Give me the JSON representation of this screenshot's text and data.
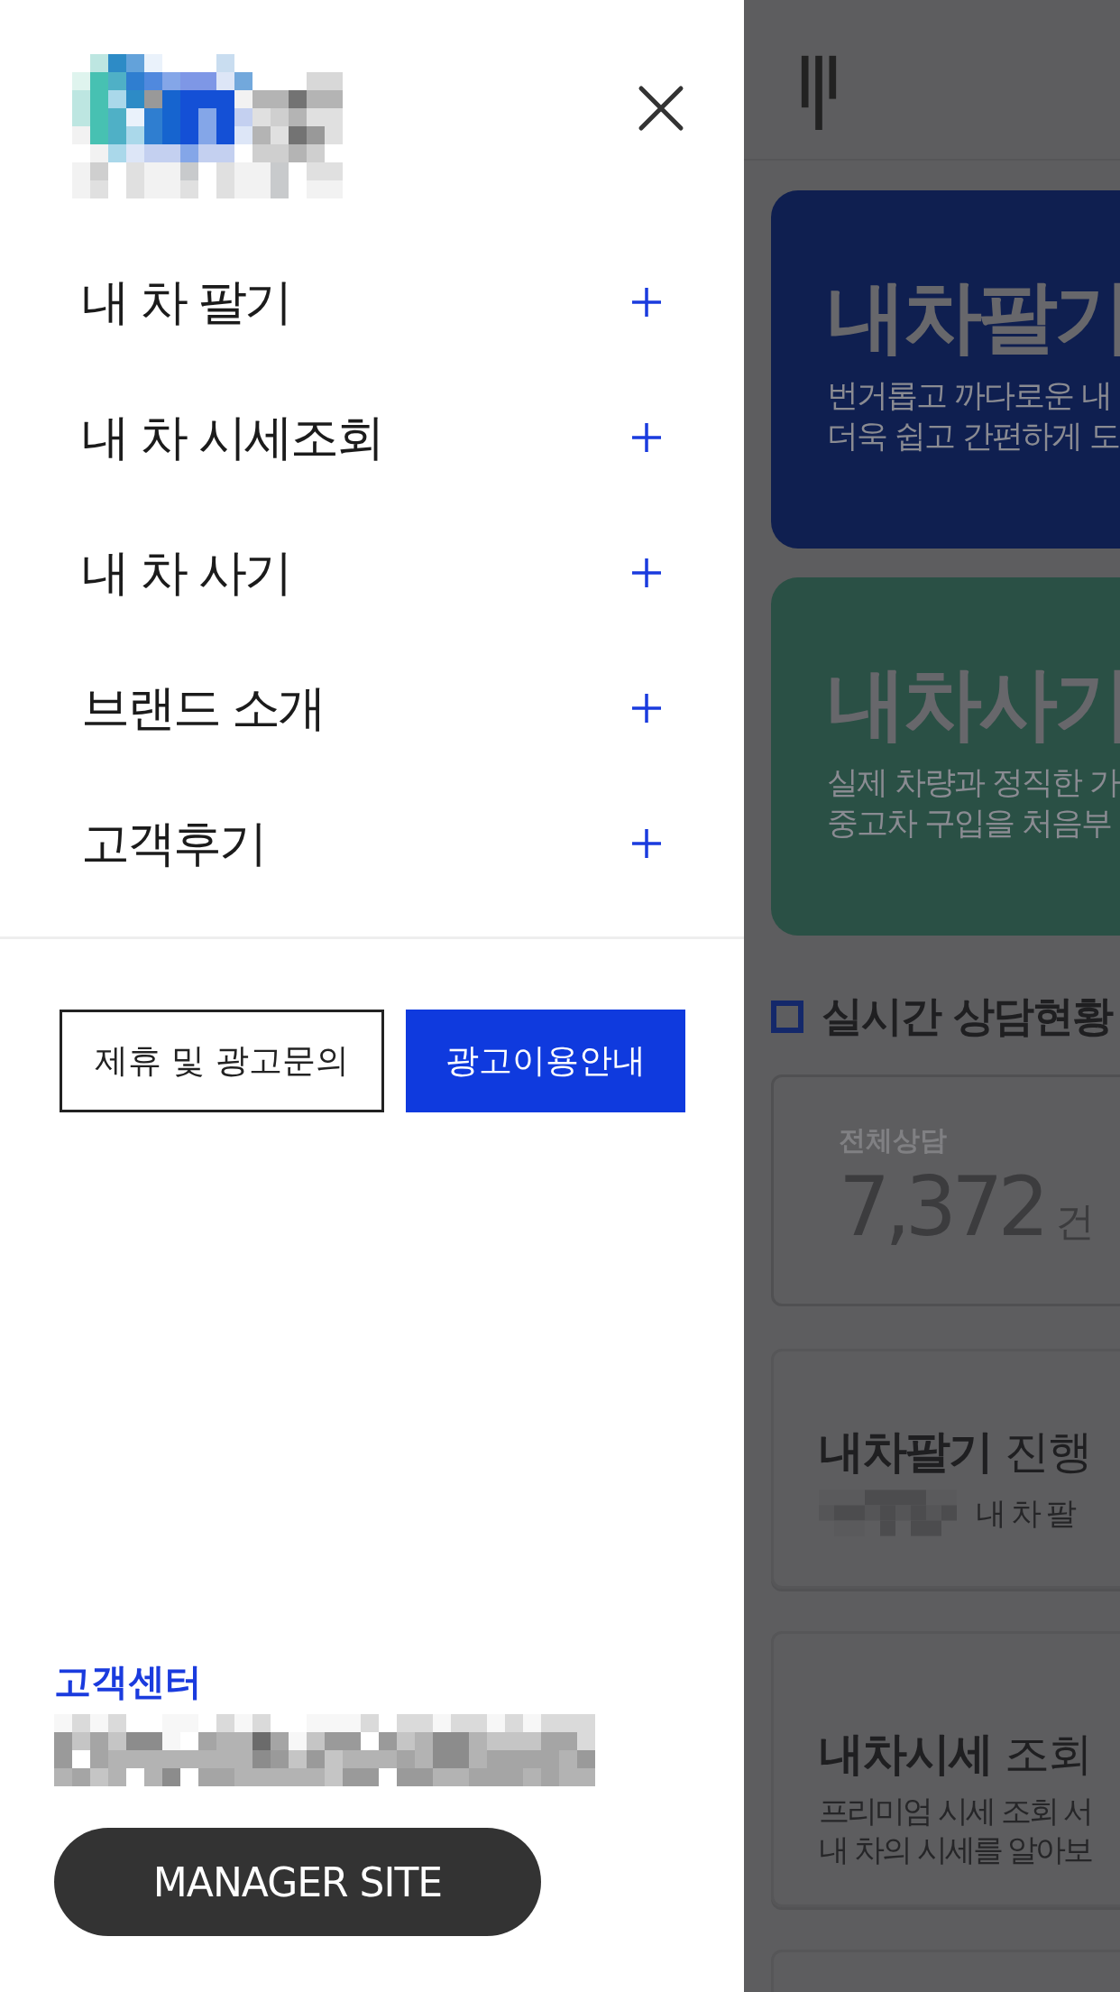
{
  "drawer": {
    "menu": [
      {
        "label": "내 차 팔기",
        "expanded": false
      },
      {
        "label": "내 차 시세조회",
        "expanded": false
      },
      {
        "label": "내 차 사기",
        "expanded": false
      },
      {
        "label": "브랜드 소개",
        "expanded": false
      },
      {
        "label": "고객후기",
        "expanded": false
      }
    ],
    "buttons": [
      {
        "label": "제휴 및 광고문의",
        "kind": "outline"
      },
      {
        "label": "광고이용안내",
        "kind": "filled"
      }
    ],
    "customer_center": {
      "title": "고객센터"
    },
    "manager_button": "MANAGER SITE"
  },
  "background_page": {
    "hero_cards": [
      {
        "title": "내차팔기",
        "lines": [
          "번거롭고 까다로운 내",
          "더욱 쉽고 간편하게 도"
        ],
        "color": "#0f1f50"
      },
      {
        "title": "내차사기",
        "lines": [
          "실제 차량과 정직한 가",
          "중고차 구입을 처음부"
        ],
        "color": "#2a5045"
      }
    ],
    "section_title": "실시간 상담현황",
    "stats": {
      "label": "전체상담",
      "value": "7,372",
      "unit": "건"
    },
    "info_cards": [
      {
        "title": "**내차팔기** 진행",
        "lines": [
          {
            "text": "내 차 팔",
            "redacted_prefix": true
          }
        ]
      },
      {
        "title": "**내차시세** 조회",
        "lines": [
          {
            "text": "프리미엄 시세 조회 서",
            "redacted_prefix": false
          },
          {
            "text": "내 차의 시세를 알아보",
            "redacted_prefix": false
          }
        ]
      }
    ]
  }
}
